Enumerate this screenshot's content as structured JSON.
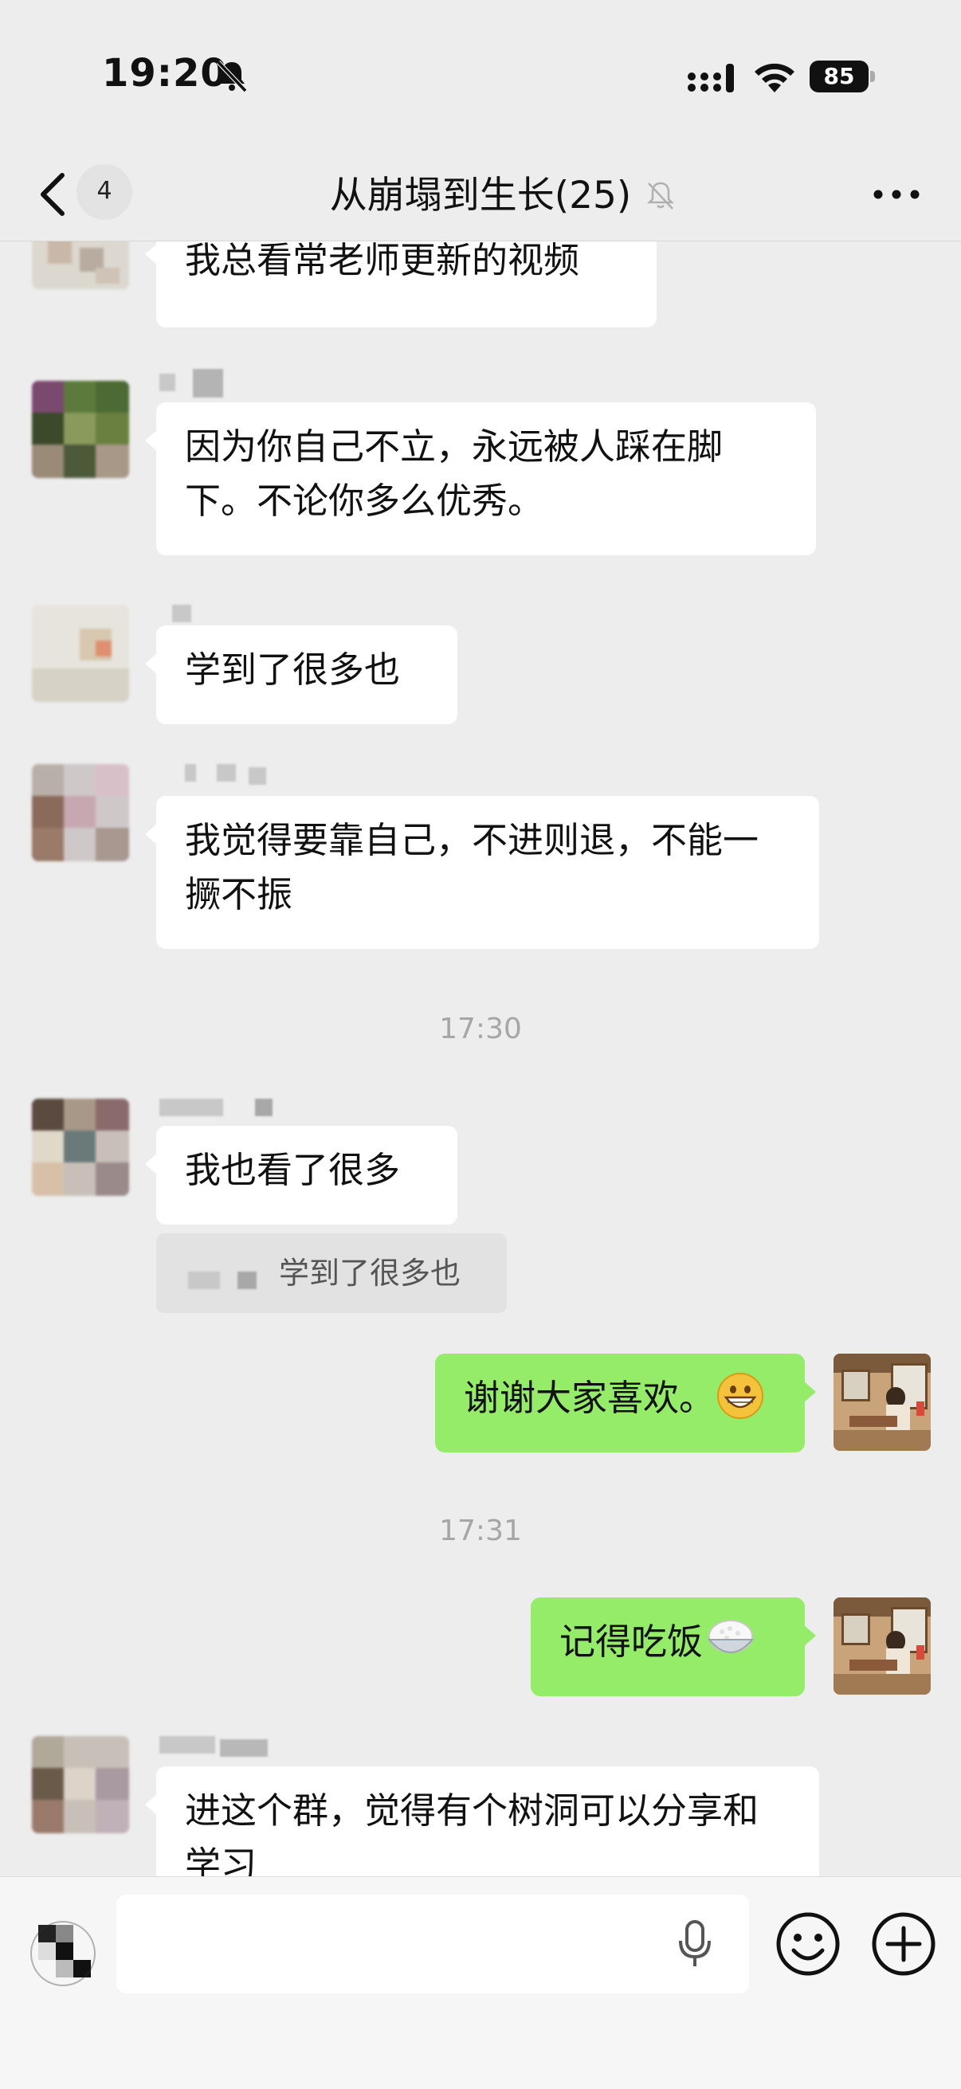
{
  "status_bar": {
    "time": "19:20",
    "battery": "85"
  },
  "nav": {
    "unread_count": "4",
    "title": "从崩塌到生长(25)"
  },
  "messages": [
    {
      "type": "in",
      "text": "我总看常老师更新的视频"
    },
    {
      "type": "in",
      "text": "因为你自己不立，永远被人踩在脚下。不论你多么优秀。"
    },
    {
      "type": "in",
      "text": "学到了很多也"
    },
    {
      "type": "in",
      "text": "我觉得要靠自己，不进则退，不能一撅不振"
    },
    {
      "type": "time",
      "text": "17:30"
    },
    {
      "type": "in",
      "text": "我也看了很多",
      "quote": "学到了很多也"
    },
    {
      "type": "out",
      "text": "谢谢大家喜欢。",
      "emoji": "grinning-face"
    },
    {
      "type": "time",
      "text": "17:31"
    },
    {
      "type": "out",
      "text": "记得吃饭",
      "emoji": "cooked-rice"
    },
    {
      "type": "in",
      "text": "进这个群，觉得有个树洞可以分享和学习"
    }
  ],
  "input": {
    "placeholder": ""
  },
  "colors": {
    "background": "#ededed",
    "incoming_bubble": "#ffffff",
    "outgoing_bubble": "#95ec69"
  },
  "icons": [
    "mute-icon",
    "signal-icon",
    "wifi-icon",
    "back-icon",
    "bell-off-icon",
    "more-icon",
    "voice-icon",
    "mic-icon",
    "emoji-icon",
    "plus-icon"
  ]
}
